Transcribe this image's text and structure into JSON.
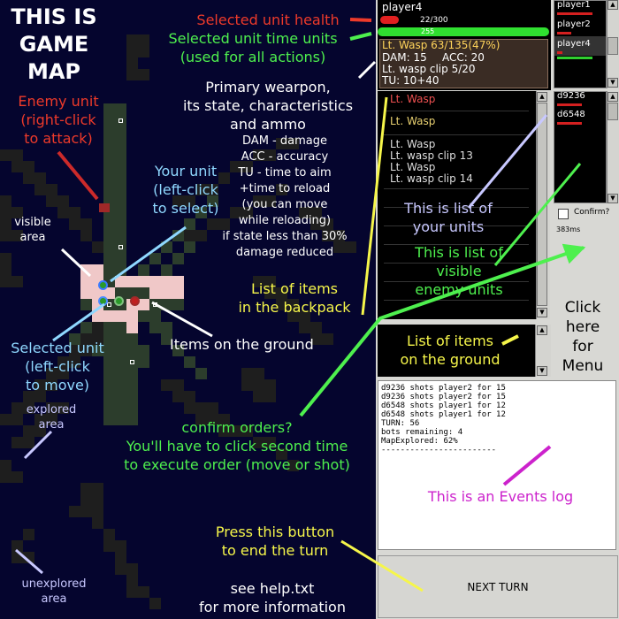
{
  "map": {
    "title": "THIS IS GAME MAP",
    "title_lines": [
      "THIS IS",
      "GAME",
      "MAP"
    ]
  },
  "annotations": {
    "enemy_unit": [
      "Enemy unit",
      "(right-click",
      "to attack)"
    ],
    "your_unit": [
      "Your unit",
      "(left-click",
      "to select)"
    ],
    "visible_area": [
      "visible",
      "area"
    ],
    "selected_unit": [
      "Selected unit",
      "(left-click",
      "to move)"
    ],
    "explored_area": [
      "explored",
      "area"
    ],
    "unexplored_area": [
      "unexplored",
      "area"
    ],
    "items_ground_map": "Items on the ground",
    "selected_health": "Selected unit health",
    "selected_tu": [
      "Selected unit time units",
      "(used for all actions)"
    ],
    "primary_weapon": [
      "Primary wearpon,",
      "its state, characteristics",
      "and ammo"
    ],
    "weapon_notes": [
      "DAM - damage",
      "ACC - accuracy",
      "TU - time to aim",
      "+time to reload",
      "(you can move",
      "while reloading)",
      "if state less than 30%",
      "damage reduced"
    ],
    "backpack": [
      "List of items",
      "in the backpack"
    ],
    "list_units": [
      "This is list of",
      "your units"
    ],
    "list_enemies": [
      "This is list of",
      "visible",
      "enemy units"
    ],
    "click_menu": [
      "Click",
      "here",
      "for",
      "Menu"
    ],
    "list_ground": [
      "List of items",
      "on the ground"
    ],
    "confirm_orders": [
      "confirm orders?",
      "You'll have to click second time",
      "to execute order (move or shot)"
    ],
    "events_log": "This is an Events log",
    "end_turn": [
      "Press this button",
      "to end the turn"
    ],
    "help": [
      "see help.txt",
      "for more information"
    ]
  },
  "panel": {
    "player_name": "player4",
    "health_text": "22/300",
    "tu_text": "255",
    "weapon": {
      "line1": "Lt. Wasp 63/135(47%)",
      "line2_dam": "DAM: 15",
      "line2_acc": "ACC: 20",
      "line3": "Lt. wasp clip 5/20",
      "line4": "TU: 10+40"
    },
    "units": [
      "player1",
      "player2",
      "player4"
    ],
    "enemies": [
      "d9236",
      "d6548"
    ],
    "confirm_label": "Confirm?",
    "timing": "383ms",
    "backpack_items": [
      "Lt. Wasp",
      "Lt. Wasp",
      "Lt. Wasp",
      "Lt. wasp clip 13",
      "Lt. Wasp",
      "Lt. wasp clip 14"
    ],
    "log": [
      "d9236 shots player2 for 15",
      "d9236 shots player2 for 15",
      "d6548 shots player1 for 12",
      "d6548 shots player1 for 12",
      "TURN: 56",
      "bots remaining: 4",
      "MapExplored: 62%",
      "------------------------"
    ],
    "next_turn": "NEXT TURN"
  },
  "colors": {
    "map_bg": "#05052e",
    "explored": "#1e1e1e",
    "visible": "#2c3d2c",
    "highlight": "#f0c8c8",
    "health_bar": "#e02020",
    "tu_bar": "#30e030",
    "panel_bg": "#d8d8d4",
    "weapon_box": "#3a2c24"
  }
}
